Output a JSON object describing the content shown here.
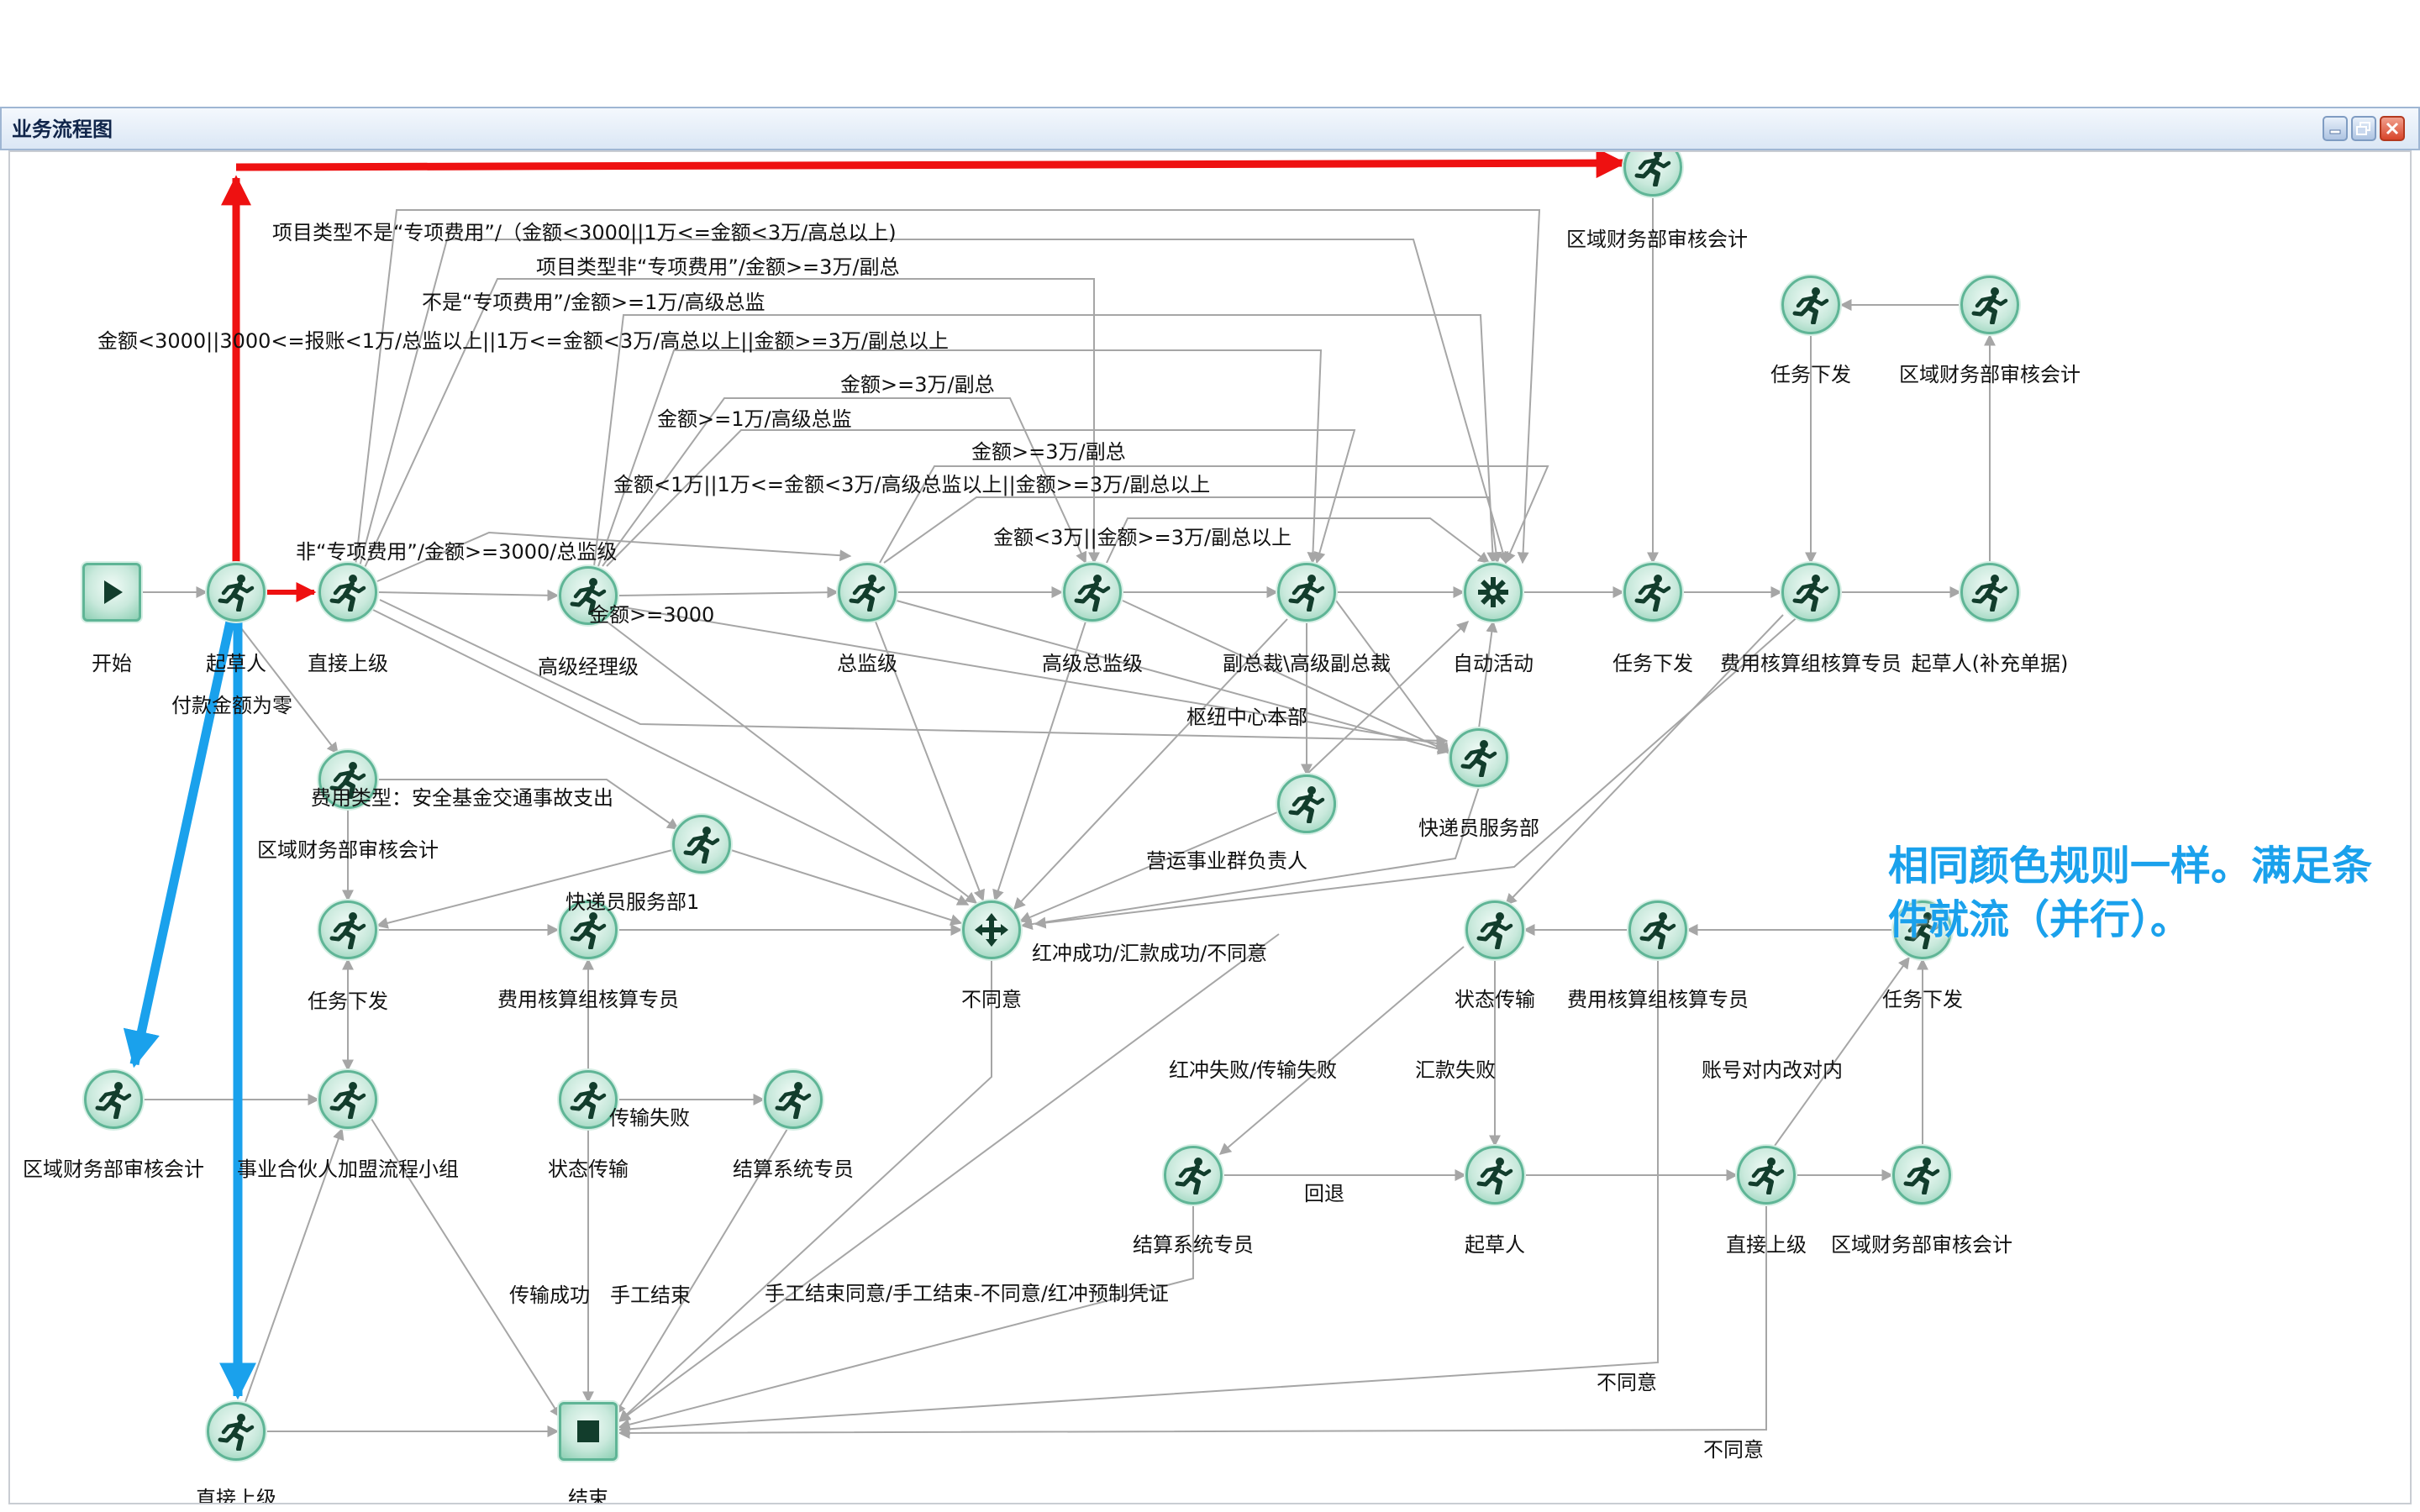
{
  "window": {
    "title": "业务流程图"
  },
  "window_controls": [
    "minimize-icon",
    "restore-icon",
    "close-icon"
  ],
  "annotation": "相同颜色规则一样。满足条件就流（并行）。",
  "colors": {
    "highlight_red": "#ee1111",
    "highlight_blue": "#1aa1ec",
    "edge_gray": "#a6a6a6",
    "node_green": "#5fb596"
  },
  "nodes": [
    {
      "id": "start",
      "label": "开始",
      "icon": "play-icon"
    },
    {
      "id": "drafter",
      "label": "起草人",
      "icon": "runner-icon"
    },
    {
      "id": "direct-superior",
      "label": "直接上级",
      "icon": "runner-icon"
    },
    {
      "id": "senior-manager",
      "label": "高级经理级",
      "icon": "runner-icon"
    },
    {
      "id": "director",
      "label": "总监级",
      "icon": "runner-icon"
    },
    {
      "id": "senior-director",
      "label": "高级总监级",
      "icon": "runner-icon"
    },
    {
      "id": "vp",
      "label": "副总裁\\高级副总裁",
      "icon": "runner-icon"
    },
    {
      "id": "auto-activity",
      "label": "自动活动",
      "icon": "gear-icon"
    },
    {
      "id": "task-dispatch-1",
      "label": "任务下发",
      "icon": "runner-icon"
    },
    {
      "id": "accounting-specialist-1",
      "label": "费用核算组核算专员",
      "icon": "runner-icon"
    },
    {
      "id": "drafter-supplement",
      "label": "起草人(补充单据)",
      "icon": "runner-icon"
    },
    {
      "id": "regional-auditor-top",
      "label": "区域财务部审核会计",
      "icon": "runner-icon"
    },
    {
      "id": "task-dispatch-2",
      "label": "任务下发",
      "icon": "runner-icon"
    },
    {
      "id": "regional-auditor-2",
      "label": "区域财务部审核会计",
      "icon": "runner-icon"
    },
    {
      "id": "hub-center",
      "label": "枢纽中心本部",
      "icon": "runner-icon"
    },
    {
      "id": "courier-dept",
      "label": "快递员服务部",
      "icon": "runner-icon"
    },
    {
      "id": "operations-head",
      "label": "营运事业群负责人",
      "icon": "runner-icon"
    },
    {
      "id": "regional-auditor-3",
      "label": "区域财务部审核会计",
      "icon": "runner-icon"
    },
    {
      "id": "expense-type-node",
      "label": "",
      "icon": "runner-icon"
    },
    {
      "id": "task-dispatch-3",
      "label": "任务下发",
      "icon": "runner-icon"
    },
    {
      "id": "accounting-specialist-2",
      "label": "费用核算组核算专员",
      "icon": "runner-icon"
    },
    {
      "id": "disagree",
      "label": "不同意",
      "icon": "move-icon"
    },
    {
      "id": "status-transmit-1",
      "label": "状态传输",
      "icon": "runner-icon"
    },
    {
      "id": "accounting-specialist-3",
      "label": "费用核算组核算专员",
      "icon": "runner-icon"
    },
    {
      "id": "task-dispatch-4",
      "label": "任务下发",
      "icon": "runner-icon"
    },
    {
      "id": "regional-auditor-4",
      "label": "区域财务部审核会计",
      "icon": "runner-icon"
    },
    {
      "id": "partner-team",
      "label": "事业合伙人加盟流程小组",
      "icon": "runner-icon"
    },
    {
      "id": "status-transmit-2",
      "label": "状态传输",
      "icon": "runner-icon"
    },
    {
      "id": "settlement-specialist-1",
      "label": "结算系统专员",
      "icon": "runner-icon"
    },
    {
      "id": "settlement-specialist-2",
      "label": "结算系统专员",
      "icon": "runner-icon"
    },
    {
      "id": "drafter-2",
      "label": "起草人",
      "icon": "runner-icon"
    },
    {
      "id": "direct-superior-2",
      "label": "直接上级",
      "icon": "runner-icon"
    },
    {
      "id": "regional-auditor-5",
      "label": "区域财务部审核会计",
      "icon": "runner-icon"
    },
    {
      "id": "direct-superior-3",
      "label": "直接上级",
      "icon": "runner-icon"
    },
    {
      "id": "end",
      "label": "结束",
      "icon": "stop-icon"
    }
  ],
  "edge_labels": [
    "项目类型不是“专项费用”/（金额<3000||1万<=金额<3万/高总以上)",
    "项目类型非“专项费用”/金额>=3万/副总",
    "不是“专项费用”/金额>=1万/高级总监",
    "金额<3000||3000<=报账<1万/总监以上||1万<=金额<3万/高总以上||金额>=3万/副总以上",
    "金额>=3万/副总",
    "金额>=1万/高级总监",
    "金额>=3万/副总",
    "金额<1万||1万<=金额<3万/高级总监以上||金额>=3万/副总以上",
    "金额<3万||金额>=3万/副总以上",
    "非“专项费用”/金额>=3000/总监级",
    "金额>=3000",
    "付款金额为零",
    "枢纽中心本部",
    "费用类型：安全基金交通事故支出",
    "营运事业群负责人",
    "快递员服务部1",
    "红冲成功/汇款成功/不同意",
    "红冲失败/传输失败",
    "汇款失败",
    "账号对内改对内",
    "传输失败",
    "回退",
    "传输成功",
    "手工结束",
    "手工结束同意/手工结束-不同意/红冲预制凭证",
    "不同意",
    "不同意"
  ]
}
